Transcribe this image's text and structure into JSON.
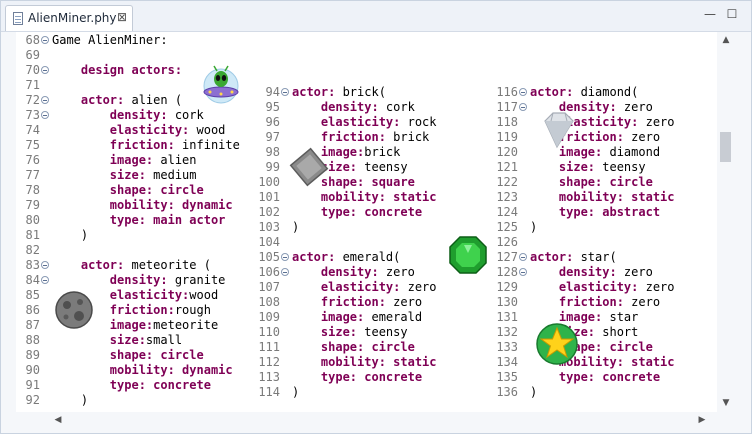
{
  "tab": {
    "title": "AlienMiner.phy",
    "close_glyph": "⊠"
  },
  "window_buttons": {
    "minimize": "—",
    "maximize": "☐"
  },
  "scroll": {
    "up": "▲",
    "down": "▼",
    "left": "◀",
    "right": "▶"
  },
  "columns": [
    {
      "lines": [
        {
          "n": "68",
          "fold": true,
          "parts": [
            {
              "t": "Game AlienMiner:",
              "c": "tx"
            }
          ]
        },
        {
          "n": "69",
          "fold": false,
          "parts": []
        },
        {
          "n": "70",
          "fold": true,
          "parts": [
            {
              "t": "    design actors:",
              "c": "kw"
            }
          ]
        },
        {
          "n": "71",
          "fold": false,
          "parts": []
        },
        {
          "n": "72",
          "fold": true,
          "parts": [
            {
              "t": "    actor: ",
              "c": "kw"
            },
            {
              "t": "alien (",
              "c": "tx"
            }
          ]
        },
        {
          "n": "73",
          "fold": true,
          "parts": [
            {
              "t": "        density: ",
              "c": "kw"
            },
            {
              "t": "cork",
              "c": "tx"
            }
          ]
        },
        {
          "n": "74",
          "fold": false,
          "parts": [
            {
              "t": "        elasticity: ",
              "c": "kw"
            },
            {
              "t": "wood",
              "c": "tx"
            }
          ]
        },
        {
          "n": "75",
          "fold": false,
          "parts": [
            {
              "t": "        friction: ",
              "c": "kw"
            },
            {
              "t": "infinite",
              "c": "tx"
            }
          ]
        },
        {
          "n": "76",
          "fold": false,
          "parts": [
            {
              "t": "        image: ",
              "c": "kw"
            },
            {
              "t": "alien",
              "c": "tx"
            }
          ]
        },
        {
          "n": "77",
          "fold": false,
          "parts": [
            {
              "t": "        size: ",
              "c": "kw"
            },
            {
              "t": "medium",
              "c": "tx"
            }
          ]
        },
        {
          "n": "78",
          "fold": false,
          "parts": [
            {
              "t": "        shape: circle",
              "c": "kw"
            }
          ]
        },
        {
          "n": "79",
          "fold": false,
          "parts": [
            {
              "t": "        mobility: dynamic",
              "c": "kw"
            }
          ]
        },
        {
          "n": "80",
          "fold": false,
          "parts": [
            {
              "t": "        type: main actor",
              "c": "kw"
            }
          ]
        },
        {
          "n": "81",
          "fold": false,
          "parts": [
            {
              "t": "    )",
              "c": "tx"
            }
          ]
        },
        {
          "n": "82",
          "fold": false,
          "parts": []
        },
        {
          "n": "83",
          "fold": true,
          "parts": [
            {
              "t": "    actor: ",
              "c": "kw"
            },
            {
              "t": "meteorite (",
              "c": "tx"
            }
          ]
        },
        {
          "n": "84",
          "fold": true,
          "parts": [
            {
              "t": "        density: ",
              "c": "kw"
            },
            {
              "t": "granite",
              "c": "tx"
            }
          ]
        },
        {
          "n": "85",
          "fold": false,
          "parts": [
            {
              "t": "        elasticity:",
              "c": "kw"
            },
            {
              "t": "wood",
              "c": "tx"
            }
          ]
        },
        {
          "n": "86",
          "fold": false,
          "parts": [
            {
              "t": "        friction:",
              "c": "kw"
            },
            {
              "t": "rough",
              "c": "tx"
            }
          ]
        },
        {
          "n": "87",
          "fold": false,
          "parts": [
            {
              "t": "        image:",
              "c": "kw"
            },
            {
              "t": "meteorite",
              "c": "tx"
            }
          ]
        },
        {
          "n": "88",
          "fold": false,
          "parts": [
            {
              "t": "        size:",
              "c": "kw"
            },
            {
              "t": "small",
              "c": "tx"
            }
          ]
        },
        {
          "n": "89",
          "fold": false,
          "parts": [
            {
              "t": "        shape: circle",
              "c": "kw"
            }
          ]
        },
        {
          "n": "90",
          "fold": false,
          "parts": [
            {
              "t": "        mobility: dynamic",
              "c": "kw"
            }
          ]
        },
        {
          "n": "91",
          "fold": false,
          "parts": [
            {
              "t": "        type: concrete",
              "c": "kw"
            }
          ]
        },
        {
          "n": "92",
          "fold": false,
          "parts": [
            {
              "t": "    )",
              "c": "tx"
            }
          ]
        }
      ]
    },
    {
      "lines": [
        {
          "n": "94",
          "fold": true,
          "parts": [
            {
              "t": "actor: ",
              "c": "kw"
            },
            {
              "t": "brick(",
              "c": "tx"
            }
          ]
        },
        {
          "n": "95",
          "fold": false,
          "parts": [
            {
              "t": "    density: ",
              "c": "kw"
            },
            {
              "t": "cork",
              "c": "tx"
            }
          ]
        },
        {
          "n": "96",
          "fold": false,
          "parts": [
            {
              "t": "    elasticity: ",
              "c": "kw"
            },
            {
              "t": "rock",
              "c": "tx"
            }
          ]
        },
        {
          "n": "97",
          "fold": false,
          "parts": [
            {
              "t": "    friction: ",
              "c": "kw"
            },
            {
              "t": "brick",
              "c": "tx"
            }
          ]
        },
        {
          "n": "98",
          "fold": false,
          "parts": [
            {
              "t": "    image:",
              "c": "kw"
            },
            {
              "t": "brick",
              "c": "tx"
            }
          ]
        },
        {
          "n": "99",
          "fold": false,
          "parts": [
            {
              "t": "    size: ",
              "c": "kw"
            },
            {
              "t": "teensy",
              "c": "tx"
            }
          ]
        },
        {
          "n": "100",
          "fold": false,
          "parts": [
            {
              "t": "    shape: square",
              "c": "kw"
            }
          ]
        },
        {
          "n": "101",
          "fold": false,
          "parts": [
            {
              "t": "    mobility: static",
              "c": "kw"
            }
          ]
        },
        {
          "n": "102",
          "fold": false,
          "parts": [
            {
              "t": "    type: concrete",
              "c": "kw"
            }
          ]
        },
        {
          "n": "103",
          "fold": false,
          "parts": [
            {
              "t": ")",
              "c": "tx"
            }
          ]
        },
        {
          "n": "104",
          "fold": false,
          "parts": []
        },
        {
          "n": "105",
          "fold": true,
          "parts": [
            {
              "t": "actor: ",
              "c": "kw"
            },
            {
              "t": "emerald(",
              "c": "tx"
            }
          ]
        },
        {
          "n": "106",
          "fold": true,
          "parts": [
            {
              "t": "    density: ",
              "c": "kw"
            },
            {
              "t": "zero",
              "c": "tx"
            }
          ]
        },
        {
          "n": "107",
          "fold": false,
          "parts": [
            {
              "t": "    elasticity: ",
              "c": "kw"
            },
            {
              "t": "zero",
              "c": "tx"
            }
          ]
        },
        {
          "n": "108",
          "fold": false,
          "parts": [
            {
              "t": "    friction: ",
              "c": "kw"
            },
            {
              "t": "zero",
              "c": "tx"
            }
          ]
        },
        {
          "n": "109",
          "fold": false,
          "parts": [
            {
              "t": "    image: ",
              "c": "kw"
            },
            {
              "t": "emerald",
              "c": "tx"
            }
          ]
        },
        {
          "n": "110",
          "fold": false,
          "parts": [
            {
              "t": "    size: ",
              "c": "kw"
            },
            {
              "t": "teensy",
              "c": "tx"
            }
          ]
        },
        {
          "n": "111",
          "fold": false,
          "parts": [
            {
              "t": "    shape: circle",
              "c": "kw"
            }
          ]
        },
        {
          "n": "112",
          "fold": false,
          "parts": [
            {
              "t": "    mobility: static",
              "c": "kw"
            }
          ]
        },
        {
          "n": "113",
          "fold": false,
          "parts": [
            {
              "t": "    type: concrete",
              "c": "kw"
            }
          ]
        },
        {
          "n": "114",
          "fold": false,
          "parts": [
            {
              "t": ")",
              "c": "tx"
            }
          ]
        }
      ]
    },
    {
      "lines": [
        {
          "n": "116",
          "fold": true,
          "parts": [
            {
              "t": "actor: ",
              "c": "kw"
            },
            {
              "t": "diamond(",
              "c": "tx"
            }
          ]
        },
        {
          "n": "117",
          "fold": true,
          "parts": [
            {
              "t": "    density: ",
              "c": "kw"
            },
            {
              "t": "zero",
              "c": "tx"
            }
          ]
        },
        {
          "n": "118",
          "fold": false,
          "parts": [
            {
              "t": "    elasticity: ",
              "c": "kw"
            },
            {
              "t": "zero",
              "c": "tx"
            }
          ]
        },
        {
          "n": "119",
          "fold": false,
          "parts": [
            {
              "t": "    friction: ",
              "c": "kw"
            },
            {
              "t": "zero",
              "c": "tx"
            }
          ]
        },
        {
          "n": "120",
          "fold": false,
          "parts": [
            {
              "t": "    image: ",
              "c": "kw"
            },
            {
              "t": "diamond",
              "c": "tx"
            }
          ]
        },
        {
          "n": "121",
          "fold": false,
          "parts": [
            {
              "t": "    size: ",
              "c": "kw"
            },
            {
              "t": "teensy",
              "c": "tx"
            }
          ]
        },
        {
          "n": "122",
          "fold": false,
          "parts": [
            {
              "t": "    shape: circle",
              "c": "kw"
            }
          ]
        },
        {
          "n": "123",
          "fold": false,
          "parts": [
            {
              "t": "    mobility: static",
              "c": "kw"
            }
          ]
        },
        {
          "n": "124",
          "fold": false,
          "parts": [
            {
              "t": "    type: abstract",
              "c": "kw"
            }
          ]
        },
        {
          "n": "125",
          "fold": false,
          "parts": [
            {
              "t": ")",
              "c": "tx"
            }
          ]
        },
        {
          "n": "126",
          "fold": false,
          "parts": []
        },
        {
          "n": "127",
          "fold": true,
          "parts": [
            {
              "t": "actor: ",
              "c": "kw"
            },
            {
              "t": "star(",
              "c": "tx"
            }
          ]
        },
        {
          "n": "128",
          "fold": true,
          "parts": [
            {
              "t": "    density: ",
              "c": "kw"
            },
            {
              "t": "zero",
              "c": "tx"
            }
          ]
        },
        {
          "n": "129",
          "fold": false,
          "parts": [
            {
              "t": "    elasticity: ",
              "c": "kw"
            },
            {
              "t": "zero",
              "c": "tx"
            }
          ]
        },
        {
          "n": "130",
          "fold": false,
          "parts": [
            {
              "t": "    friction: ",
              "c": "kw"
            },
            {
              "t": "zero",
              "c": "tx"
            }
          ]
        },
        {
          "n": "131",
          "fold": false,
          "parts": [
            {
              "t": "    image: ",
              "c": "kw"
            },
            {
              "t": "star",
              "c": "tx"
            }
          ]
        },
        {
          "n": "132",
          "fold": false,
          "parts": [
            {
              "t": "    size: ",
              "c": "kw"
            },
            {
              "t": "short",
              "c": "tx"
            }
          ]
        },
        {
          "n": "133",
          "fold": false,
          "parts": [
            {
              "t": "    shape: circle",
              "c": "kw"
            }
          ]
        },
        {
          "n": "134",
          "fold": false,
          "parts": [
            {
              "t": "    mobility: static",
              "c": "kw"
            }
          ]
        },
        {
          "n": "135",
          "fold": false,
          "parts": [
            {
              "t": "    type: concrete",
              "c": "kw"
            }
          ]
        },
        {
          "n": "136",
          "fold": false,
          "parts": [
            {
              "t": ")",
              "c": "tx"
            }
          ]
        }
      ]
    }
  ],
  "sprites": [
    "alien-ufo-icon",
    "brick-icon",
    "meteorite-icon",
    "emerald-icon",
    "diamond-icon",
    "star-icon"
  ],
  "colors": {
    "keyword": "#7f0055",
    "text": "#000000",
    "line_number": "#7a7a7a"
  }
}
